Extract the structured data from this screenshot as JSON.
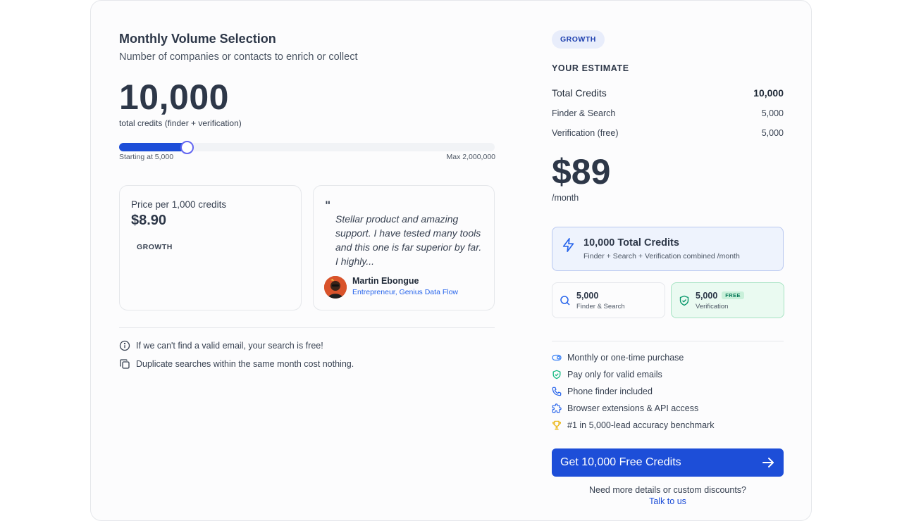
{
  "left": {
    "title": "Monthly Volume Selection",
    "subtitle": "Number of companies or contacts to enrich or collect",
    "volume": "10,000",
    "volume_caption": "total credits (finder + verification)",
    "slider": {
      "min_label": "Starting at 5,000",
      "max_label": "Max 2,000,000",
      "fill_fraction": 0.18
    },
    "price_card": {
      "label": "Price per 1,000 credits",
      "value": "$8.90",
      "tier": "GROWTH"
    },
    "testimonial": {
      "quote_mark": "\"",
      "text": "Stellar product and amazing support. I have tested many tools and this one is far superior by far. I highly...",
      "author": "Martin Ebongue",
      "role": "Entrepreneur, Genius Data Flow"
    },
    "notes": [
      {
        "icon": "info-circle-icon",
        "text": "If we can't find a valid email, your search is free!"
      },
      {
        "icon": "copy-icon",
        "text": "Duplicate searches within the same month cost nothing."
      }
    ]
  },
  "right": {
    "tier_badge": "GROWTH",
    "estimate_heading": "YOUR ESTIMATE",
    "total_credits": {
      "label": "Total Credits",
      "value": "10,000"
    },
    "finder": {
      "label": "Finder & Search",
      "value": "5,000"
    },
    "verification": {
      "label": "Verification (free)",
      "value": "5,000"
    },
    "price": "$89",
    "per_month": "/month",
    "credits_summary": {
      "title": "10,000 Total Credits",
      "subtitle": "Finder + Search + Verification combined /month"
    },
    "mini_finder": {
      "value": "5,000",
      "label": "Finder & Search"
    },
    "mini_verification": {
      "value": "5,000",
      "label": "Verification",
      "tag": "FREE"
    },
    "features": [
      {
        "icon": "toggle-icon",
        "text": "Monthly or one-time purchase",
        "color": "#3b82f6"
      },
      {
        "icon": "shield-check-icon",
        "text": "Pay only for valid emails",
        "color": "#10b981"
      },
      {
        "icon": "phone-icon",
        "text": "Phone finder included",
        "color": "#2563eb"
      },
      {
        "icon": "puzzle-icon",
        "text": "Browser extensions & API access",
        "color": "#2563eb"
      },
      {
        "icon": "trophy-icon",
        "text": "#1 in 5,000-lead accuracy benchmark",
        "color": "#eab308"
      }
    ],
    "cta_label": "Get 10,000 Free Credits",
    "help_text": "Need more details or custom discounts?",
    "talk_link": "Talk to us"
  },
  "colors": {
    "accent": "#1d4ed8",
    "success": "#10b981",
    "gold": "#eab308"
  }
}
